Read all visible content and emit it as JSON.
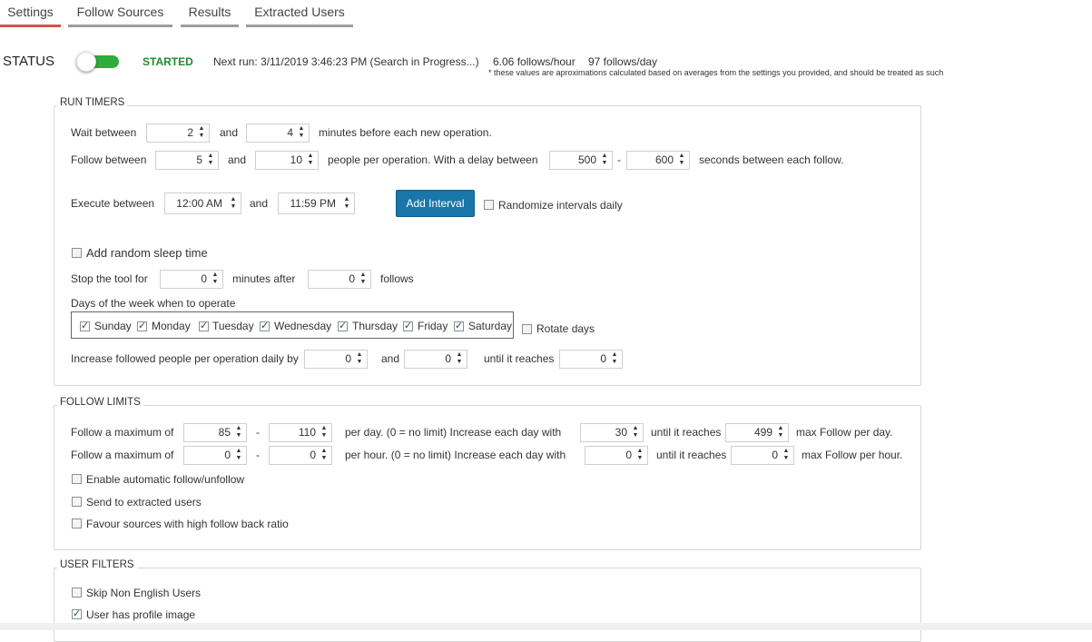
{
  "tabs": [
    {
      "label": "Settings"
    },
    {
      "label": "Follow Sources"
    },
    {
      "label": "Results"
    },
    {
      "label": "Extracted Users"
    }
  ],
  "status": {
    "label": "STATUS",
    "state": "STARTED",
    "toggle_on": true,
    "next_run": "Next run: 3/11/2019 3:46:23 PM (Search in Progress...)",
    "follows_hour": "6.06 follows/hour",
    "follows_day": "97 follows/day",
    "note": "* these values are aproximations calculated based on averages from the settings you provided, and should be treated as such"
  },
  "run_timers": {
    "title": "RUN TIMERS",
    "wait_label": "Wait between",
    "wait_min": "2",
    "and1": "and",
    "wait_max": "4",
    "wait_suffix": "minutes before each new operation.",
    "follow_label": "Follow between",
    "follow_min": "5",
    "and2": "and",
    "follow_max": "10",
    "follow_mid": "people per operation. With a delay between",
    "delay_min": "500",
    "dash": "-",
    "delay_max": "600",
    "delay_suffix": "seconds between each follow.",
    "exec_label": "Execute between",
    "exec_start": "12:00 AM",
    "and3": "and",
    "exec_end": "11:59 PM",
    "add_interval": "Add Interval",
    "randomize": "Randomize intervals daily",
    "random_sleep": "Add random sleep time",
    "stop_label": "Stop the tool for",
    "stop_minutes": "0",
    "stop_mid": "minutes after",
    "stop_follows": "0",
    "stop_suffix": "follows",
    "days_label": "Days of the week when to operate",
    "days": [
      "Sunday",
      "Monday",
      "Tuesday",
      "Wednesday",
      "Thursday",
      "Friday",
      "Saturday"
    ],
    "rotate_days": "Rotate days",
    "increase_label": "Increase followed people per operation daily by",
    "increase_min": "0",
    "and4": "and",
    "increase_max": "0",
    "until_label": "until it reaches",
    "until_val": "0"
  },
  "follow_limits": {
    "title": "FOLLOW LIMITS",
    "row1": {
      "label": "Follow a maximum of",
      "min": "85",
      "dash": "-",
      "max": "110",
      "mid": "per day. (0 = no limit)  Increase each day with",
      "inc": "30",
      "until": "until it reaches",
      "reach": "499",
      "suffix": "max Follow per day."
    },
    "row2": {
      "label": "Follow a maximum of",
      "min": "0",
      "dash": "-",
      "max": "0",
      "mid": "per hour. (0 = no limit)  Increase each day with",
      "inc": "0",
      "until": "until it reaches",
      "reach": "0",
      "suffix": "max Follow per hour."
    },
    "auto_follow": "Enable automatic follow/unfollow",
    "send_extracted": "Send to extracted users",
    "favour_sources": "Favour sources with high follow back ratio"
  },
  "user_filters": {
    "title": "USER FILTERS",
    "skip_non_english": "Skip Non English Users",
    "has_profile_image": "User has profile image"
  }
}
